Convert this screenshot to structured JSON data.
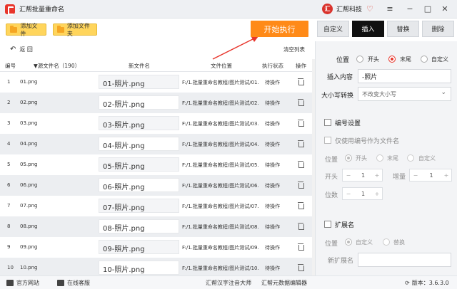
{
  "app": {
    "title": "汇帮批量重命名",
    "brand": "汇帮科技"
  },
  "toolbar": {
    "add_file": "添加文件",
    "add_folder": "添加文件夹",
    "start": "开始执行"
  },
  "tabs": [
    "自定义",
    "插入",
    "替换",
    "删除"
  ],
  "left": {
    "back": "返 回",
    "clear": "清空列表"
  },
  "table": {
    "headers": {
      "index": "编号",
      "source": "源文件名（190）",
      "new": "新文件名",
      "location": "文件位置",
      "status": "执行状态",
      "action": "操作"
    },
    "rows": [
      {
        "idx": "1",
        "src": "01.png",
        "new": "01-照片.png",
        "loc": "F:/1.批量重命名教程/图片测试/01.png",
        "status": "待操作"
      },
      {
        "idx": "2",
        "src": "02.png",
        "new": "02-照片.png",
        "loc": "F:/1.批量重命名教程/图片测试/02.png",
        "status": "待操作"
      },
      {
        "idx": "3",
        "src": "03.png",
        "new": "03-照片.png",
        "loc": "F:/1.批量重命名教程/图片测试/03.png",
        "status": "待操作"
      },
      {
        "idx": "4",
        "src": "04.png",
        "new": "04-照片.png",
        "loc": "F:/1.批量重命名教程/图片测试/04.png",
        "status": "待操作"
      },
      {
        "idx": "5",
        "src": "05.png",
        "new": "05-照片.png",
        "loc": "F:/1.批量重命名教程/图片测试/05.png",
        "status": "待操作"
      },
      {
        "idx": "6",
        "src": "06.png",
        "new": "06-照片.png",
        "loc": "F:/1.批量重命名教程/图片测试/06.png",
        "status": "待操作"
      },
      {
        "idx": "7",
        "src": "07.png",
        "new": "07-照片.png",
        "loc": "F:/1.批量重命名教程/图片测试/07.png",
        "status": "待操作"
      },
      {
        "idx": "8",
        "src": "08.png",
        "new": "08-照片.png",
        "loc": "F:/1.批量重命名教程/图片测试/08.png",
        "status": "待操作"
      },
      {
        "idx": "9",
        "src": "09.png",
        "new": "09-照片.png",
        "loc": "F:/1.批量重命名教程/图片测试/09.png",
        "status": "待操作"
      },
      {
        "idx": "10",
        "src": "10.png",
        "new": "10-照片.png",
        "loc": "F:/1.批量重命名教程/图片测试/10.png",
        "status": "待操作"
      }
    ]
  },
  "panel": {
    "position_label": "位置",
    "position_options": [
      "开头",
      "末尾",
      "自定义"
    ],
    "insert_label": "插入内容",
    "insert_value": "-照片",
    "case_label": "大小写转换",
    "case_value": "不改变大小写",
    "numbering_label": "编号设置",
    "only_number_label": "仅使用编号作为文件名",
    "num_position_label": "位置",
    "num_position_options": [
      "开头",
      "末尾",
      "自定义"
    ],
    "start_label": "开头",
    "start_value": "1",
    "step_label": "增量",
    "step_value": "1",
    "digits_label": "位数",
    "digits_value": "1",
    "ext_label": "扩展名",
    "ext_position_label": "位置",
    "ext_options": [
      "自定义",
      "替换"
    ],
    "new_ext_label": "新扩展名"
  },
  "footer": {
    "website": "官方网站",
    "service": "在线客服",
    "tool1": "汇帮汉字注音大师",
    "tool2": "汇帮元数据编辑器",
    "version": "版本：3.6.3.0"
  },
  "colors": {
    "accent": "#e8352b",
    "start_button": "#ff8a18",
    "yellow_button": "#ffd55c"
  }
}
